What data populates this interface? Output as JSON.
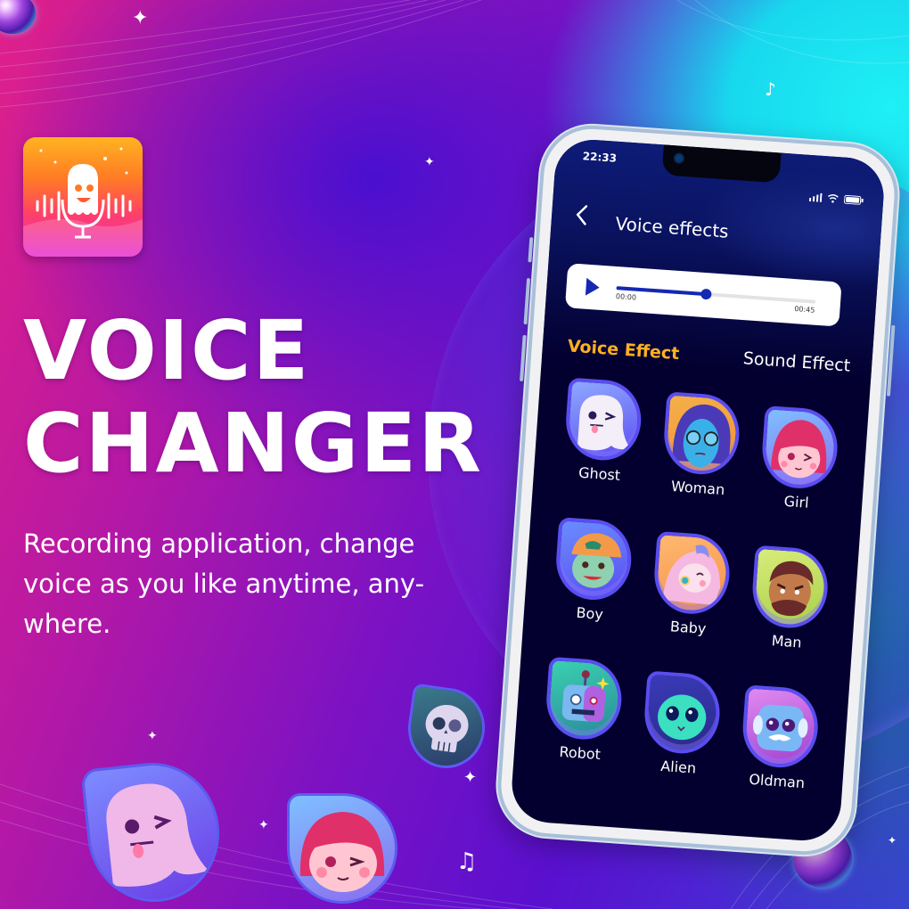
{
  "hero": {
    "title_line1": "VOICE",
    "title_line2": "CHANGER",
    "subtitle": "Recording application, change voice as you like anytime, any-where."
  },
  "app_icon": {
    "icon": "ghost-microphone-icon",
    "colors": [
      "#ffb321",
      "#ff3f6a",
      "#e62ad0"
    ]
  },
  "phone": {
    "status_bar": {
      "time": "22:33",
      "icons": [
        "signal-icon",
        "wifi-icon",
        "battery-icon"
      ]
    },
    "header": {
      "back_icon": "chevron-left-icon",
      "title": "Voice effects"
    },
    "player": {
      "play_icon": "play-icon",
      "current_time": "00:00",
      "total_time": "00:45",
      "progress_percent": 45,
      "accent_color": "#1428b4"
    },
    "tabs": [
      {
        "label": "Voice Effect",
        "active": true,
        "color": "#ffb020"
      },
      {
        "label": "Sound Effect",
        "active": false,
        "color": "#ffffff"
      }
    ],
    "effects": [
      {
        "label": "Ghost",
        "icon": "ghost-avatar-icon",
        "bg": "#8fa8ff"
      },
      {
        "label": "Woman",
        "icon": "woman-avatar-icon",
        "bg": "#f5b04a"
      },
      {
        "label": "Girl",
        "icon": "girl-avatar-icon",
        "bg": "#8a7bf5"
      },
      {
        "label": "Boy",
        "icon": "boy-avatar-icon",
        "bg": "#5f6cf2"
      },
      {
        "label": "Baby",
        "icon": "baby-avatar-icon",
        "bg": "#f7a85a"
      },
      {
        "label": "Man",
        "icon": "man-avatar-icon",
        "bg": "#b6dc5a"
      },
      {
        "label": "Robot",
        "icon": "robot-avatar-icon",
        "bg": "#2fb0a0"
      },
      {
        "label": "Alien",
        "icon": "alien-avatar-icon",
        "bg": "#3b3ab8"
      },
      {
        "label": "Oldman",
        "icon": "oldman-avatar-icon",
        "bg": "#c66ae0"
      }
    ]
  },
  "decorations": {
    "floating_badges": [
      "ghost-avatar-icon",
      "girl-avatar-icon",
      "skull-avatar-icon"
    ],
    "notes": [
      "music-note-icon",
      "music-note-icon"
    ],
    "bubbles": [
      "bubble-icon",
      "bubble-icon"
    ]
  }
}
